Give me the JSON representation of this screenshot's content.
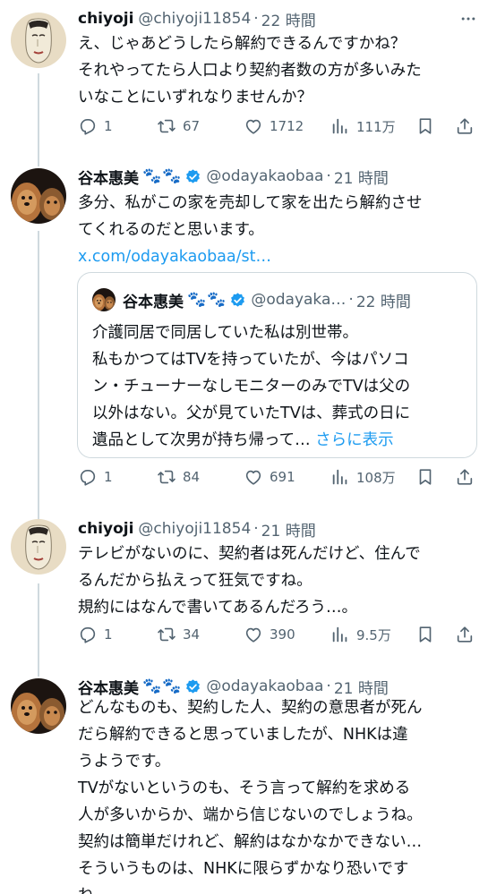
{
  "tweets": [
    {
      "name": "chiyoji",
      "handle": "@chiyoji11854",
      "dot": "·",
      "time": "22 時間",
      "lines": [
        "え、じゃあどうしたら解約できるんですかね？",
        "それやってたら人口より契約者数の方が多いみた",
        "いなことにいずれなりませんか？"
      ],
      "replies": "1",
      "retweets": "67",
      "likes": "1712",
      "views": "111万"
    },
    {
      "name": "谷本惠美",
      "paws": "🐾🐾",
      "handle": "@odayakaobaa",
      "dot": "·",
      "time": "21 時間",
      "lines": [
        "多分、私がこの家を売却して家を出たら解約させ",
        "てくれるのだと思います。"
      ],
      "link": "x.com/odayakaobaa/st…",
      "quote": {
        "name": "谷本惠美",
        "paws": "🐾🐾",
        "handle": "@odayaka…",
        "dot": "·",
        "time": "22 時間",
        "lines": [
          "介護同居で同居していた私は別世帯。",
          "私もかつてはTVを持っていたが、今はパソコ",
          "ン・チューナーなしモニターのみでTVは父の",
          "以外はない。父が見ていたTVは、葬式の日に",
          "遺品として次男が持ち帰って… "
        ],
        "show_more": "さらに表示"
      },
      "replies": "1",
      "retweets": "84",
      "likes": "691",
      "views": "108万"
    },
    {
      "name": "chiyoji",
      "handle": "@chiyoji11854",
      "dot": "·",
      "time": "21 時間",
      "lines": [
        "テレビがないのに、契約者は死んだけど、住んで",
        "るんだから払えって狂気ですね。",
        "規約にはなんで書いてあるんだろう…。"
      ],
      "replies": "1",
      "retweets": "34",
      "likes": "390",
      "views": "9.5万"
    },
    {
      "name": "谷本惠美",
      "paws": "🐾🐾",
      "handle": "@odayakaobaa",
      "dot": "·",
      "time": "21 時間",
      "lines": [
        "どんなものも、契約した人、契約の意思者が死ん",
        "だら解約できると思っていましたが、NHKは違",
        "うようです。",
        "TVがないというのも、そう言って解約を求める",
        "人が多いからか、端から信じないのでしょうね。",
        "契約は簡単だけれど、解約はなかなかできない…",
        "そういうものは、NHKに限らずかなり恐いです",
        "ね。"
      ]
    }
  ],
  "colors": {
    "text": "#0f1419",
    "secondary": "#536471",
    "link": "#1d9bf0",
    "verified": "#1d9bf0",
    "thread_line": "#cfd9de"
  },
  "icons": [
    "more-icon",
    "reply-icon",
    "retweet-icon",
    "like-icon",
    "views-icon",
    "bookmark-icon",
    "share-icon",
    "verified-badge-icon"
  ]
}
